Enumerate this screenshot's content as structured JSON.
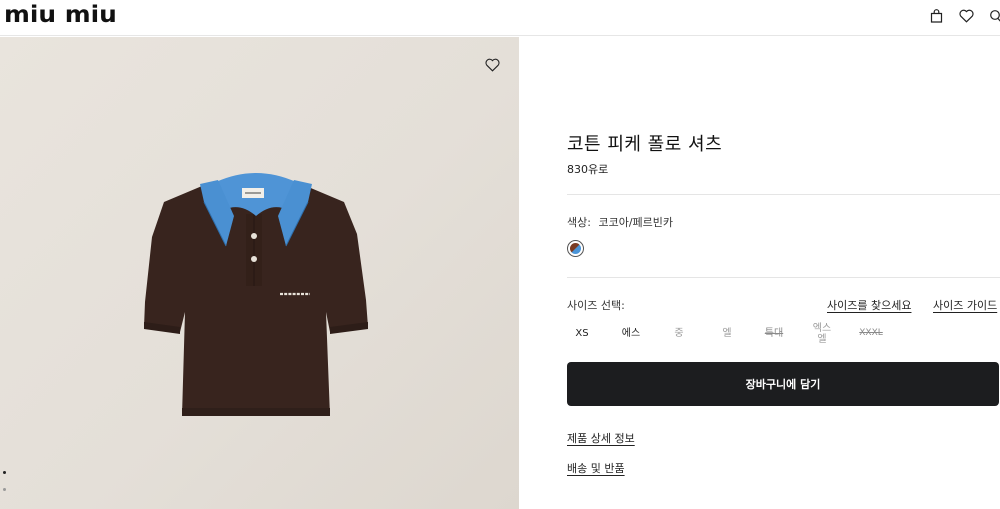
{
  "brand": {
    "logo": "miu miu"
  },
  "header": {
    "icons": [
      "bag-icon",
      "heart-icon",
      "search-icon"
    ]
  },
  "gallery": {
    "product_image": "polo-shirt-image",
    "colors": {
      "body": "#3a2620",
      "collar": "#4f94d6",
      "background": "#e6e1da"
    }
  },
  "product": {
    "title": "코튼 피케 폴로 셔츠",
    "price": "830유로",
    "color_label": "색상:",
    "color_value": "코코아/페르빈카",
    "size_label": "사이즈 선택:",
    "find_size_link": "사이즈를 찾으세요",
    "size_guide_link": "사이즈 가이드",
    "sizes": [
      {
        "label": "XS",
        "state": "available"
      },
      {
        "label": "에스",
        "state": "available"
      },
      {
        "label": "중",
        "state": "unavailable"
      },
      {
        "label": "엘",
        "state": "unavailable"
      },
      {
        "label": "특대",
        "state": "sold-out"
      },
      {
        "label": "엑스\n엘",
        "state": "unavailable"
      },
      {
        "label": "XXXL",
        "state": "sold-out"
      }
    ],
    "add_to_cart": "장바구니에 담기",
    "details_link": "제품 상세 정보",
    "shipping_link": "배송 및 반품"
  },
  "accent_colors": {
    "button": "#1c1d1f",
    "text": "#1b1b1b"
  }
}
